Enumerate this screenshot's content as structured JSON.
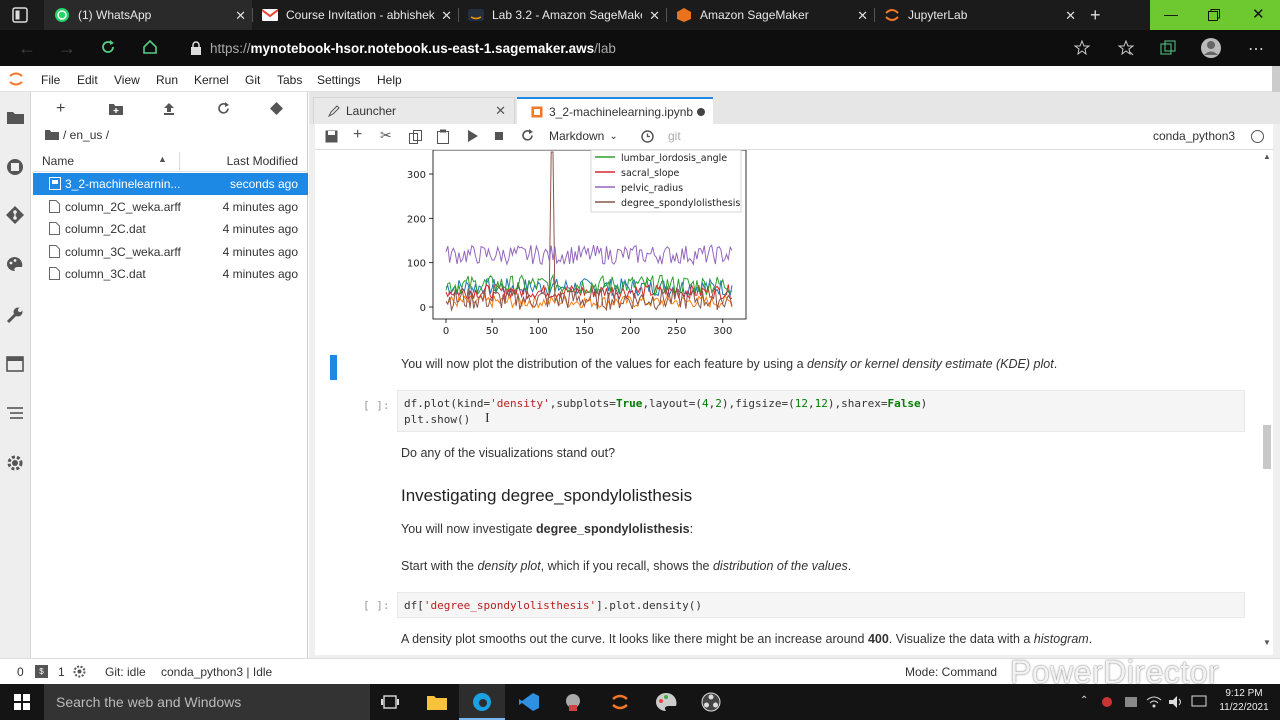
{
  "browser": {
    "tabs": [
      {
        "label": "(1) WhatsApp",
        "icon": "whatsapp-icon"
      },
      {
        "label": "Course Invitation - abhishek",
        "icon": "gmail-icon"
      },
      {
        "label": "Lab 3.2 - Amazon SageMake",
        "icon": "aws-icon"
      },
      {
        "label": "Amazon SageMaker",
        "icon": "sagemaker-icon"
      },
      {
        "label": "JupyterLab",
        "icon": "jupyter-icon"
      }
    ],
    "url_prefix": "https://",
    "url_host": "mynotebook-hsor.notebook.us-east-1.sagemaker.aws",
    "url_path": "/lab",
    "accent": "#6dc92f"
  },
  "menubar": [
    "File",
    "Edit",
    "View",
    "Run",
    "Kernel",
    "Git",
    "Tabs",
    "Settings",
    "Help"
  ],
  "filebrowser": {
    "path": "/ en_us /",
    "col_name": "Name",
    "col_modified": "Last Modified",
    "files": [
      {
        "name": "3_2-machinelearnin...",
        "modified": "seconds ago",
        "selected": true,
        "type": "notebook"
      },
      {
        "name": "column_2C_weka.arff",
        "modified": "4 minutes ago",
        "selected": false,
        "type": "file"
      },
      {
        "name": "column_2C.dat",
        "modified": "4 minutes ago",
        "selected": false,
        "type": "file"
      },
      {
        "name": "column_3C_weka.arff",
        "modified": "4 minutes ago",
        "selected": false,
        "type": "file"
      },
      {
        "name": "column_3C.dat",
        "modified": "4 minutes ago",
        "selected": false,
        "type": "file"
      }
    ]
  },
  "doc_tabs": [
    {
      "label": "Launcher"
    },
    {
      "label": "3_2-machinelearning.ipynb"
    }
  ],
  "toolbar": {
    "cell_type": "Markdown",
    "git": "git",
    "kernel": "conda_python3"
  },
  "notebook": {
    "plot": {
      "yticks": [
        "300",
        "200",
        "100",
        "0"
      ],
      "xticks": [
        "0",
        "50",
        "100",
        "150",
        "200",
        "250",
        "300"
      ],
      "legend": [
        {
          "label": "lumbar_lordosis_angle",
          "color": "#2ca02c"
        },
        {
          "label": "sacral_slope",
          "color": "#d62728"
        },
        {
          "label": "pelvic_radius",
          "color": "#9467bd"
        },
        {
          "label": "degree_spondylolisthesis",
          "color": "#8c564b"
        }
      ]
    },
    "md1": {
      "pre": "You will now plot the distribution of the values for each feature by using a ",
      "em": "density or kernel density estimate (KDE) plot",
      "post": "."
    },
    "cell1": {
      "prompt": "[ ]:",
      "line1": {
        "a": "df.plot(kind=",
        "s1": "'density'",
        "b": ",subplots=",
        "k1": "True",
        "c": ",layout=(",
        "n1": "4",
        "d": ",",
        "n2": "2",
        "e": "),figsize=(",
        "n3": "12",
        "f": ",",
        "n4": "12",
        "g": "),sharex=",
        "k2": "False",
        "h": ")"
      },
      "line2": "plt.show()"
    },
    "md2": "Do any of the visualizations stand out?",
    "heading": "Investigating degree_spondylolisthesis",
    "md3": {
      "pre": "You will now investigate ",
      "bold": "degree_spondylolisthesis",
      "post": ":"
    },
    "md4": {
      "a": "Start with the ",
      "em1": "density plot",
      "b": ", which if you recall, shows the ",
      "em2": "distribution of the values",
      "c": "."
    },
    "cell2": {
      "prompt": "[ ]:",
      "a": "df[",
      "s": "'degree_spondylolisthesis'",
      "b": "].plot.density()"
    },
    "md5": {
      "a": "A density plot smooths out the curve. It looks like there might be an increase around ",
      "bold": "400",
      "b": ". Visualize the data with a ",
      "em": "histogram",
      "c": "."
    }
  },
  "status": {
    "zero": "0",
    "one": "1",
    "git": "Git: idle",
    "kernel": "conda_python3 | Idle",
    "mode": "Mode: Command"
  },
  "watermark": "PowerDirector",
  "taskbar": {
    "search": "Search the web and Windows",
    "time": "9:12 PM",
    "date": "11/22/2021"
  }
}
